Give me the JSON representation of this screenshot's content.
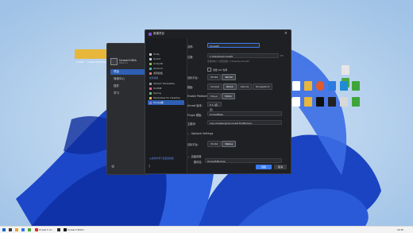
{
  "desktop": {
    "left_icons": [
      {
        "label": "Folder",
        "color": "#e8b63a"
      },
      {
        "label": "Folder",
        "color": "#e8b63a"
      },
      {
        "label": "RiderFolder",
        "color": "#e8b63a"
      }
    ],
    "right_icons_row1": [
      {
        "label": "ext",
        "color": "#e6e6e6"
      },
      {
        "label": "",
        "color": "#4aa83d"
      }
    ],
    "right_icons_row2": [
      {
        "label": "",
        "color": "#ffffff"
      },
      {
        "label": "code",
        "color": "#e8b63a"
      },
      {
        "label": "rtkcart",
        "color": "#e05a2c"
      },
      {
        "label": "blueApp",
        "color": "#2d7be0"
      },
      {
        "label": "Pkit",
        "color": "#1f8bd6"
      },
      {
        "label": "appSet",
        "color": "#3fa53a"
      }
    ],
    "right_icons_row3": [
      {
        "label": "",
        "color": "#ffffff"
      },
      {
        "label": "code",
        "color": "#e8b63a"
      },
      {
        "label": "MoveTo",
        "color": "#111111"
      },
      {
        "label": "NutLs",
        "color": "#222222"
      },
      {
        "label": "flex",
        "color": "#d8d8d8"
      },
      {
        "label": "ApLe",
        "color": "#3fa53a"
      }
    ]
  },
  "launcher": {
    "name": "Unreal+DSA",
    "subtitle": "2022.2.1",
    "nav": [
      "项目",
      "商城中心",
      "插件",
      "学习"
    ]
  },
  "dialog": {
    "title": "新建项目",
    "sidebar": [
      {
        "label": "Unity",
        "color": "#cfcfcf"
      },
      {
        "label": "Godot",
        "color": "#cfcfcf"
      },
      {
        "label": "Unity3D",
        "color": "#8bc34a"
      },
      {
        "label": "Android",
        "color": "#4db6ac"
      },
      {
        "label": "游戏模板",
        "color": "#e57373"
      }
    ],
    "sidebar_heading": "插件模板",
    "sidebar_plugins": [
      {
        "label": "Stream Templates",
        "color": "#9e9e9e"
      },
      {
        "label": "UnitDB",
        "color": "#f06292"
      },
      {
        "label": "Spring",
        "color": "#66bb6a"
      },
      {
        "label": "Templates for Desktop",
        "color": "#ffb74d"
      },
      {
        "label": "Unreal版",
        "color": "#9575cd",
        "active": true
      }
    ],
    "sidebar_link": "从插件市场下载更多模板",
    "fields": {
      "name_label": "名称:",
      "name_value": "Unreal5",
      "location_label": "位置:",
      "location_value": "C:\\Desktop\\Unreal5",
      "location_hint": "项目将在以下位置创建: C:\\Desktop\\Unreal5",
      "git_label": "创建 Git 仓库",
      "platform_label": "目标平台:",
      "platform_options": [
        "Win64",
        "Win32"
      ],
      "template_label": "模板:",
      "template_options": [
        "Sample",
        "Blank",
        "Vehicle",
        "BudgetGrid"
      ],
      "bp_label": "Enable Platform:",
      "bp_options": [
        "Player",
        "Editor"
      ],
      "engine_label": "Unreal 版本:",
      "engine_value": "5.1 (自定)",
      "plugin_label": "Plugin 模板:",
      "plugin_value": "UnrealBase",
      "module_label": "主模块:",
      "module_value": "org.unrealengine.unreal.FirstPerson",
      "optional_label": "Optional Settings",
      "optional_field_label": "目标平台:",
      "optional_options": [
        "Win64",
        "Native"
      ],
      "advanced_label": "高级设置",
      "advanced_field_label": "模块名:",
      "advanced_value": "Unreal5Module"
    },
    "buttons": {
      "create": "创建",
      "cancel": "取消"
    }
  },
  "taskbar": {
    "items": [
      {
        "label": "",
        "color": "#0a62c9"
      },
      {
        "label": "",
        "color": "#3a3a3a"
      },
      {
        "label": "",
        "color": "#e4a63a"
      },
      {
        "label": "",
        "color": "#2d7be0"
      },
      {
        "label": "",
        "color": "#4aa83d"
      },
      {
        "label": "Unreal 5 (1)",
        "color": "#d93025"
      },
      {
        "label": "",
        "color": "#2b2b2b"
      },
      {
        "label": "Unreal 5 Editor",
        "color": "#111111"
      }
    ],
    "time": "14:35"
  }
}
